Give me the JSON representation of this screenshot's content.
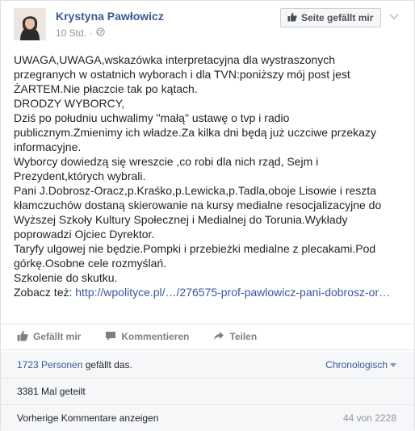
{
  "post": {
    "author": "Krystyna Pawłowicz",
    "time": "10 Std.",
    "separator": "·",
    "like_page_label": "Seite gefällt mir",
    "body_lines": [
      "UWAGA,UWAGA,wskazówka interpretacyjna dla wystraszonych",
      "przegranych w ostatnich wyborach i dla TVN:poniższy mój post jest",
      "ŻARTEM.Nie płaczcie tak po kątach.",
      "DRODZY WYBORCY,",
      "Dziś po południu uchwalimy \"małą\" ustawę o tvp i radio",
      "publicznym.Zmienimy ich władze.Za kilka dni będą już uczciwe przekazy",
      "informacyjne.",
      "Wyborcy dowiedzą się wreszcie ,co robi dla nich rząd, Sejm i",
      "Prezydent,których wybrali.",
      "Pani J.Dobrosz-Oracz,p.Kraśko,p.Lewicka,p.Tadla,oboje Lisowie i reszta",
      "kłamczuchów dostaną skierowanie na kursy medialne resocjalizacyjne do",
      "Wyższej Szkoły Kultury Społecznej i Medialnej do Torunia.Wykłady",
      "poprowadzi Ojciec Dyrektor.",
      "Taryfy ulgowej nie będzie.Pompki i przebieżki medialne z plecakami.Pod",
      "górkę.Osobne cele rozmyślań.",
      "Szkolenie do skutku."
    ],
    "see_also_label": "Zobacz też:",
    "see_also_link": "http://wpolityce.pl/…/276575-prof-pawlowicz-pani-dobrosz-or…"
  },
  "actions": {
    "like": "Gefällt mir",
    "comment": "Kommentieren",
    "share": "Teilen"
  },
  "stats": {
    "likes_count": "1723 Personen",
    "likes_suffix": "gefällt das.",
    "sort_label": "Chronologisch",
    "shares": "3381 Mal geteilt",
    "previous_comments": "Vorherige Kommentare anzeigen",
    "comment_count": "44 von 2228"
  },
  "colors": {
    "link": "#365899",
    "muted": "#90949c",
    "text": "#1d2129"
  },
  "icons": [
    "globe-icon",
    "thumbs-up-icon",
    "chevron-down-icon",
    "comment-icon",
    "share-icon"
  ]
}
